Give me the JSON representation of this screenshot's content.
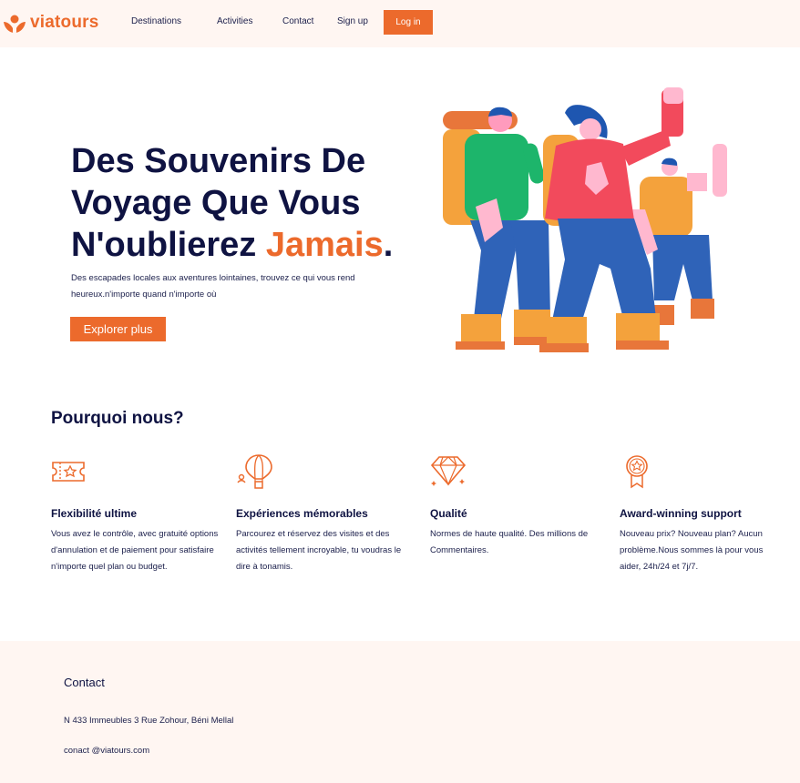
{
  "header": {
    "logo_text": "viatours",
    "nav": [
      "Destinations",
      "Activities",
      "Contact",
      "Sign up"
    ],
    "login_label": "Log in",
    "colors": {
      "background": "#fff6f2",
      "accent": "#ec6a2c"
    }
  },
  "hero": {
    "title_part1": "Des Souvenirs De Voyage Que Vous N'oublierez ",
    "title_accent": "Jamais",
    "title_end": ".",
    "subtitle": "Des escapades locales aux aventures lointaines, trouvez ce qui vous rend heureux.n'importe quand n'importe où",
    "cta_label": "Explorer plus",
    "illustration": "three-hikers-illustration"
  },
  "why": {
    "title": "Pourquoi nous?",
    "features": [
      {
        "icon": "ticket-icon",
        "title": "Flexibilité ultime",
        "desc": "Vous avez le contrôle, avec gratuité options d'annulation et de paiement pour satisfaire n'importe quel plan ou budget."
      },
      {
        "icon": "hot-air-balloon-icon",
        "title": " Expériences mémorables",
        "desc": "Parcourez et réservez des visites et des activités tellement incroyable, tu voudras le dire à tonamis."
      },
      {
        "icon": "diamond-icon",
        "title": "Qualité",
        "desc": "Normes de haute qualité. Des millions de Commentaires."
      },
      {
        "icon": "award-medal-icon",
        "title": "Award-winning support",
        "desc": "Nouveau prix? Nouveau plan? Aucun problème.Nous sommes là pour vous aider, 24h/24 et 7j/7."
      }
    ]
  },
  "footer": {
    "title": "Contact",
    "address": "N 433 Immeubles 3 Rue Zohour, Béni Mellal",
    "email": "conact @viatours.com"
  }
}
